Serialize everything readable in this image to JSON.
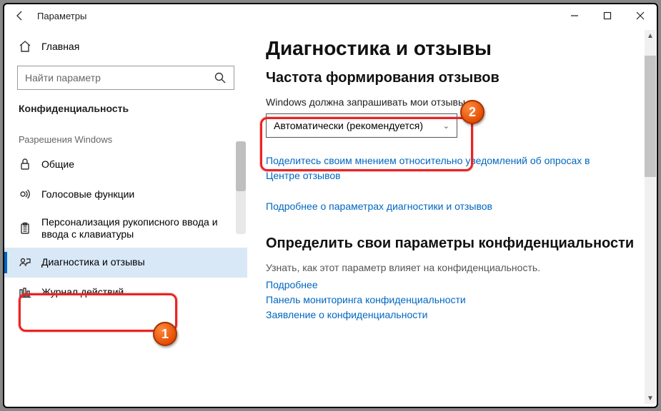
{
  "window": {
    "title": "Параметры"
  },
  "sidebar": {
    "home": "Главная",
    "search_placeholder": "Найти параметр",
    "category": "Конфиденциальность",
    "group": "Разрешения Windows",
    "items": [
      {
        "label": "Общие"
      },
      {
        "label": "Голосовые функции"
      },
      {
        "label": "Персонализация рукописного ввода и ввода с клавиатуры"
      },
      {
        "label": "Диагностика и отзывы"
      },
      {
        "label": "Журнал действий"
      }
    ]
  },
  "main": {
    "h1": "Диагностика и отзывы",
    "section1": {
      "heading": "Частота формирования отзывов",
      "label": "Windows должна запрашивать мои отзывы",
      "dropdown_value": "Автоматически (рекомендуется)"
    },
    "link1": "Поделитесь своим мнением относительно уведомлений об опросах в Центре отзывов",
    "link2": "Подробнее о параметрах диагностики и отзывов",
    "section2": {
      "heading": "Определить свои параметры конфиденциальности",
      "desc": "Узнать, как этот параметр влияет на конфиденциальность.",
      "more": "Подробнее",
      "dash": "Панель мониторинга конфиденциальности",
      "stmt": "Заявление о конфиденциальности"
    }
  },
  "annotations": {
    "badge1": "1",
    "badge2": "2"
  }
}
